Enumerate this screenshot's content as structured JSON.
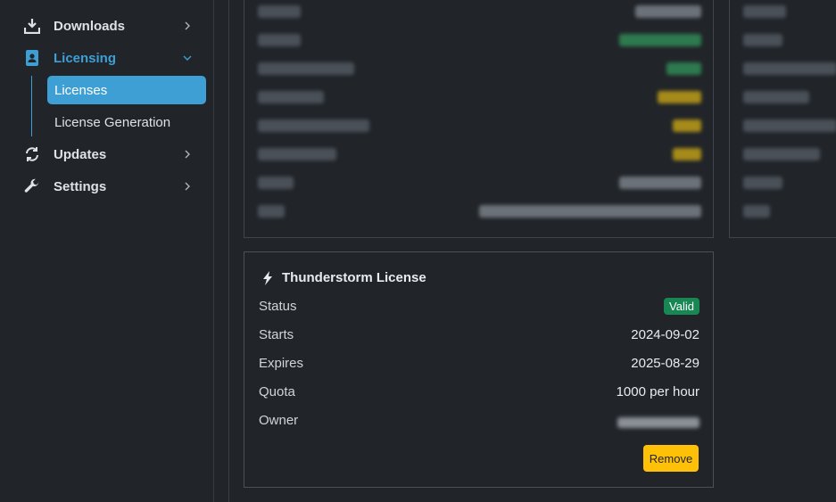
{
  "sidebar": {
    "items": [
      {
        "id": "downloads",
        "label": "Downloads",
        "icon": "download-icon"
      },
      {
        "id": "licensing",
        "label": "Licensing",
        "icon": "id-badge-icon",
        "active": true
      },
      {
        "id": "updates",
        "label": "Updates",
        "icon": "sync-icon"
      },
      {
        "id": "settings",
        "label": "Settings",
        "icon": "wrench-icon"
      }
    ],
    "subitems": [
      {
        "label": "Licenses",
        "active": true
      },
      {
        "label": "License Generation"
      }
    ]
  },
  "license_card": {
    "title": "Thunderstorm License",
    "icon": "bolt-icon",
    "rows": {
      "status_label": "Status",
      "status_value": "Valid",
      "starts_label": "Starts",
      "starts_value": "2024-09-02",
      "expires_label": "Expires",
      "expires_value": "2025-08-29",
      "quota_label": "Quota",
      "quota_value": "1000 per hour",
      "owner_label": "Owner"
    },
    "remove_label": "Remove"
  },
  "colors": {
    "accent": "#3d9fd4",
    "valid": "#198754",
    "warning": "#ffc107",
    "background": "#212529"
  }
}
